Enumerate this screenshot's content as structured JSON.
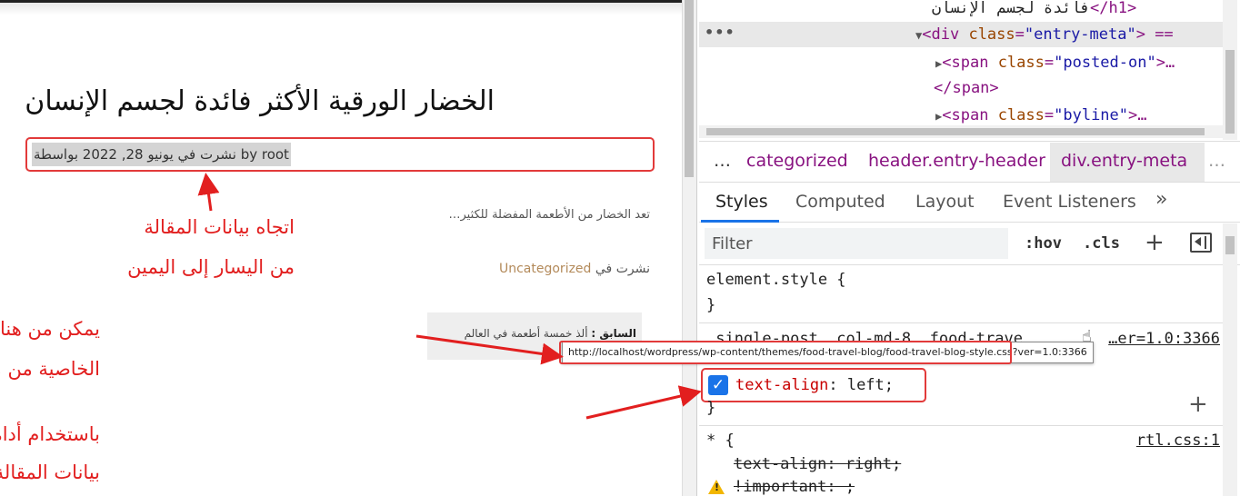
{
  "page": {
    "title": "الخضار الورقية الأكثر فائدة لجسم الإنسان",
    "meta": "نشرت في يونيو 28, 2022 بواسطة by root",
    "excerpt": "تعد الخضار من الأطعمة المفضلة للكثير…",
    "posted_in_label": "نشرت في",
    "category": "Uncategorized",
    "prev_label": "السابق :",
    "prev_title": "ألذ خمسة أطعمة في العالم"
  },
  "annotations": {
    "meta_direction_1": "اتجاه بيانات المقالة",
    "meta_direction_2": "من اليسار إلى اليمين",
    "file_hint_1": "يمكن من هنا معرفة الملف الذي يتضمن",
    "file_hint_2": "الخاصية من ملفات القالب",
    "inspect_1": "باستخدام أداة الفحص في متصفح جوجل كروم، وجدنا أنه طبق على",
    "inspect_2": "بيانات المقالة خاصية تجعل اتجاه النص في العنصر من اليسار إلى اليمين",
    "color": "#e21f1f"
  },
  "devtools": {
    "dom": {
      "h1_text": "فائدة لجسم الإنسان",
      "h1_close": "</h1>",
      "div_tag": "div",
      "class_attr": "class",
      "div_class": "\"entry-meta\"",
      "div_suffix": "> ==",
      "span_tag": "span",
      "posted_on": "\"posted-on\"",
      "span_close": "</span>",
      "byline": "\"byline\"",
      "ellipsis": ">…",
      "dots": "•••"
    },
    "breadcrumbs": [
      "…",
      "categorized",
      "header.entry-header",
      "div.entry-meta",
      "…"
    ],
    "tabs": [
      "Styles",
      "Computed",
      "Layout",
      "Event Listeners",
      "»"
    ],
    "filter_placeholder": "Filter",
    "hov": ":hov",
    "cls": ".cls",
    "element_style": "element.style {",
    "close_brace": "}",
    "rule_selector": ".single-post .col-md-8 .food-trave",
    "rule_source": "…er=1.0:3366",
    "tooltip_url": "http://localhost/wordpress/wp-content/themes/food-travel-blog/food-travel-blog-style.css?ver=1.0:3366",
    "decl_prop": "text-align",
    "decl_value": ": left;",
    "star_selector": "* {",
    "rtl_source": "rtl.css:1",
    "strike_decl": "text-align: right;",
    "strike_important": "!important: ;",
    "accent": "#1a73e8"
  }
}
